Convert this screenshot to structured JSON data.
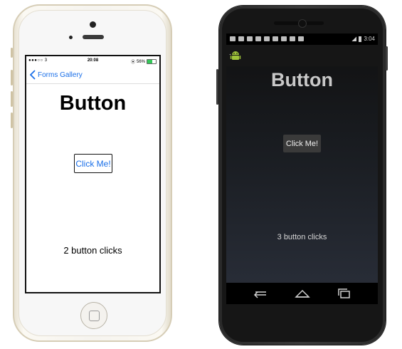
{
  "ios": {
    "status": {
      "carrier": "●●●○○ 3",
      "time": "20:08",
      "battery_text": "56%",
      "battery_level": 0.56
    },
    "nav": {
      "back_label": "Forms Gallery"
    },
    "title": "Button",
    "button_label": "Click Me!",
    "count_text": "2 button clicks"
  },
  "android": {
    "status": {
      "time": "3:04"
    },
    "title": "Button",
    "button_label": "Click Me!",
    "count_text": "3 button clicks"
  },
  "colors": {
    "ios_link": "#1a6fe8",
    "ios_battery": "#34c759",
    "android_bg_top": "#101010",
    "android_bg_bottom": "#2a2f3a"
  }
}
